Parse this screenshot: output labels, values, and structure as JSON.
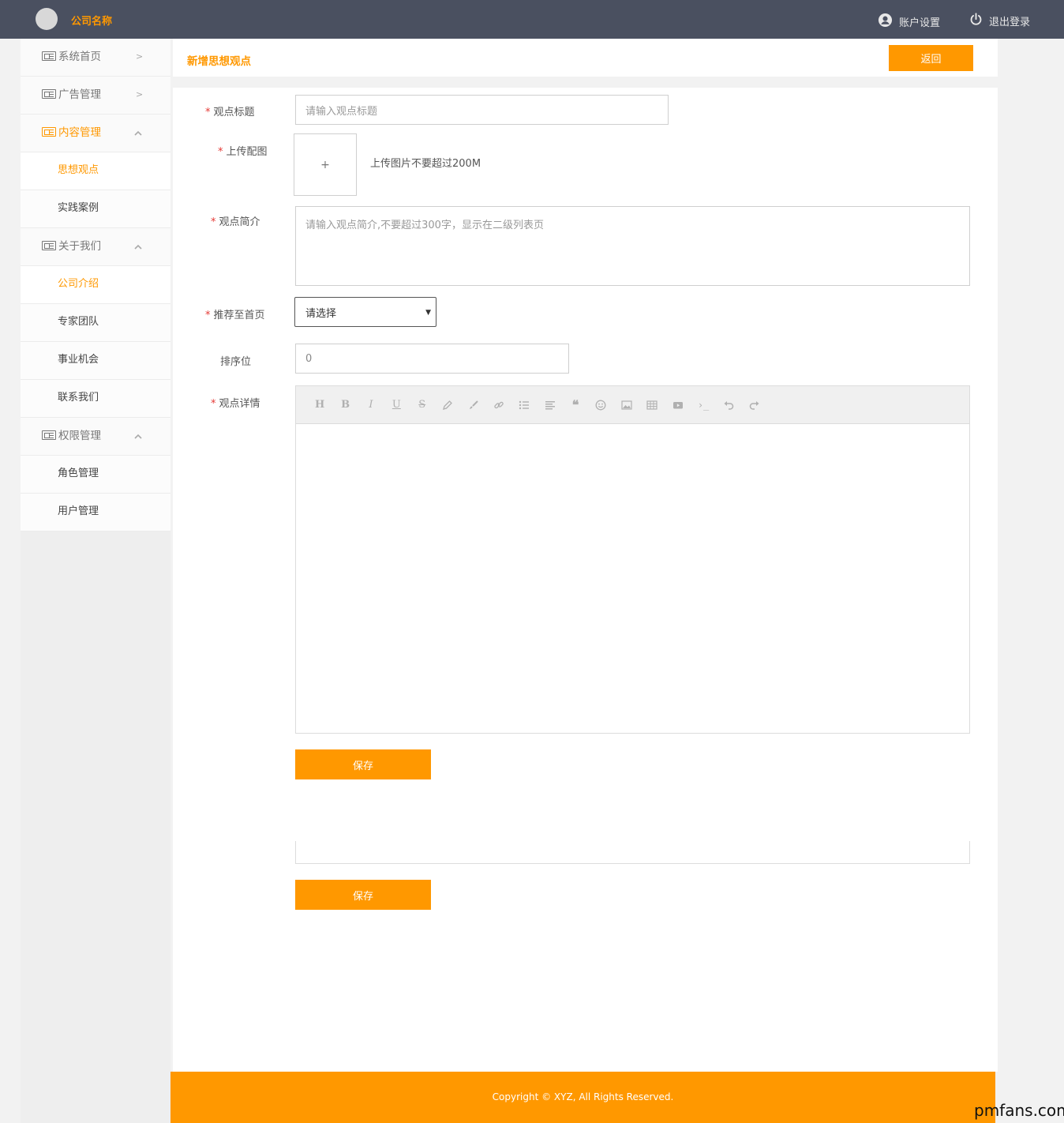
{
  "header": {
    "brand": "公司名称",
    "account_settings": "账户设置",
    "logout": "退出登录"
  },
  "sidebar": {
    "items": [
      {
        "label": "系统首页",
        "indicator": ">"
      },
      {
        "label": "广告管理",
        "indicator": ">"
      },
      {
        "label": "内容管理",
        "children": [
          "思想观点",
          "实践案例"
        ]
      },
      {
        "label": "关于我们",
        "children": [
          "公司介绍",
          "专家团队",
          "事业机会",
          "联系我们"
        ]
      },
      {
        "label": "权限管理",
        "children": [
          "角色管理",
          "用户管理"
        ]
      }
    ]
  },
  "page": {
    "title": "新增思想观点",
    "back_button": "返回"
  },
  "form": {
    "title_label": "观点标题",
    "title_placeholder": "请输入观点标题",
    "image_label": "上传配图",
    "upload_plus": "+",
    "upload_hint": "上传图片不要超过200M",
    "summary_label": "观点简介",
    "summary_placeholder": "请输入观点简介,不要超过300字，显示在二级列表页",
    "recommend_label": "推荐至首页",
    "recommend_selected": "请选择",
    "sort_label": "排序位",
    "sort_value": "0",
    "detail_label": "观点详情",
    "required_mark": "*",
    "save_button": "保存",
    "save_button_2": "保存"
  },
  "editor_toolbar": [
    "H",
    "B",
    "I",
    "U",
    "S",
    "pencil-icon",
    "brush-icon",
    "link-icon",
    "bullet-list-icon",
    "align-icon",
    "quote-icon",
    "emoji-icon",
    "image-icon",
    "table-icon",
    "video-icon",
    "code-icon",
    "undo-icon",
    "redo-icon"
  ],
  "footer": {
    "copyright": "Copyright © XYZ, All Rights Reserved."
  },
  "watermark": "pmfans.com",
  "colors": {
    "accent": "#ff9800",
    "header_bg": "#4a5060",
    "required": "#e53935"
  }
}
